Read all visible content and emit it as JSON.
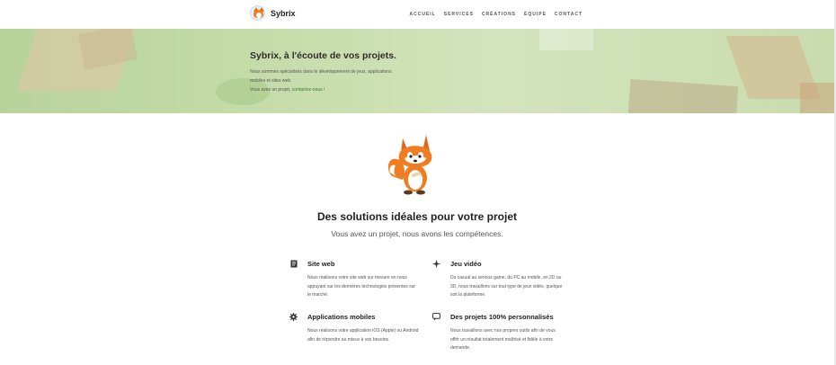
{
  "header": {
    "brand": "Sybrix",
    "nav": [
      "Accueil",
      "Services",
      "Créations",
      "Équipe",
      "Contact"
    ]
  },
  "hero": {
    "title": "Sybrix, à l'écoute de vos projets.",
    "line1": "Nous sommes spécialisés dans le développement de jeux, applications",
    "line2": "mobiles et sites web.",
    "line3_prefix": "Vous avez un projet, ",
    "line3_link": "contactez-nous",
    "line3_suffix": " !"
  },
  "section": {
    "title": "Des solutions idéales pour votre projet",
    "subtitle": "Vous avez un projet, nous avons les compétences."
  },
  "features": [
    {
      "icon": "document-icon",
      "title": "Site web",
      "text": "Nous réalisons votre site web sur mesure en nous appuyant sur les dernières technologies présentes sur le marché."
    },
    {
      "icon": "sparkle-icon",
      "title": "Jeu vidéo",
      "text": "Du casual au serious game, du PC au mobile, en 2D ou 3D, nous travaillons sur tout type de jeux vidéo, quelque soit la plateforme."
    },
    {
      "icon": "gear-icon",
      "title": "Applications mobiles",
      "text": "Nous réalisons votre application iOS (Apple) ou Android afin de répondre au mieux à vos besoins."
    },
    {
      "icon": "chat-bubble-icon",
      "title": "Des projets 100% personnalisés",
      "text": "Nous travaillons avec nos propres outils afin de vous offrir un résultat totalement maîtrisé et fidèle à votre demande."
    }
  ],
  "colors": {
    "link": "#2e7d32",
    "hero_bg": "#c4dca8",
    "fox": "#f07d22"
  }
}
